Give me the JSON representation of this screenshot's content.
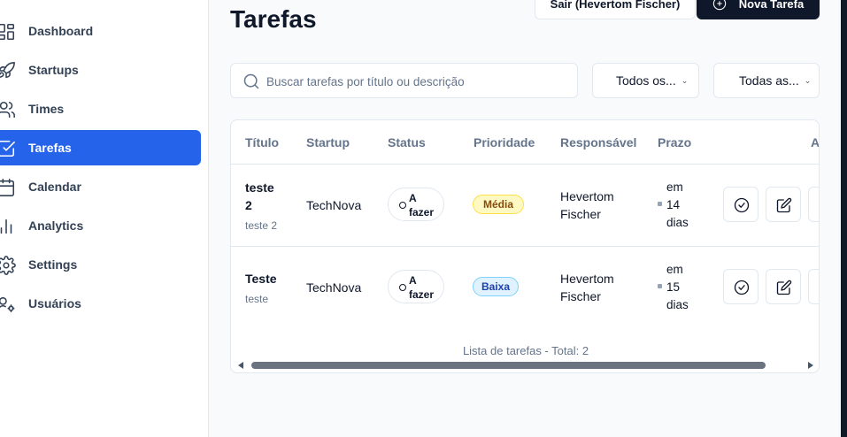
{
  "sidebar": {
    "items": [
      {
        "label": "Dashboard",
        "icon": "dashboard-icon"
      },
      {
        "label": "Startups",
        "icon": "rocket-icon"
      },
      {
        "label": "Times",
        "icon": "users-icon"
      },
      {
        "label": "Tarefas",
        "icon": "checkbox-icon",
        "active": true
      },
      {
        "label": "Calendar",
        "icon": "calendar-icon"
      },
      {
        "label": "Analytics",
        "icon": "bar-chart-icon"
      },
      {
        "label": "Settings",
        "icon": "gear-icon"
      },
      {
        "label": "Usuários",
        "icon": "user-settings-icon"
      }
    ]
  },
  "header": {
    "title": "Tarefas",
    "logout_label": "Sair (Hevertom Fischer)",
    "new_task_label": "Nova Tarefa"
  },
  "filters": {
    "search_placeholder": "Buscar tarefas por título ou descrição",
    "status_select": "Todos os...",
    "priority_select": "Todas as..."
  },
  "table": {
    "columns": [
      "Título",
      "Startup",
      "Status",
      "Prioridade",
      "Responsável",
      "Prazo",
      "A"
    ],
    "rows": [
      {
        "title_line1": "teste",
        "title_line2": "2",
        "description": "teste 2",
        "startup": "TechNova",
        "status_line1": "A",
        "status_line2": "fazer",
        "priority": "Média",
        "assignee_line1": "Hevertom",
        "assignee_line2": "Fischer",
        "deadline": [
          "em",
          "14",
          "dias"
        ]
      },
      {
        "title_line1": "Teste",
        "title_line2": "",
        "description": "teste",
        "startup": "TechNova",
        "status_line1": "A",
        "status_line2": "fazer",
        "priority": "Baixa",
        "assignee_line1": "Hevertom",
        "assignee_line2": "Fischer",
        "deadline": [
          "em",
          "15",
          "dias"
        ]
      }
    ],
    "caption": "Lista de tarefas - Total: 2"
  },
  "colors": {
    "accent": "#2563eb",
    "primary_button": "#0f172a",
    "priority_medium_bg": "#fef9c3",
    "priority_low_bg": "#e0f2fe"
  }
}
